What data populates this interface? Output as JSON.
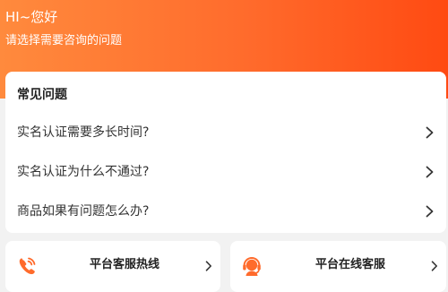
{
  "header": {
    "greeting": "HI~您好",
    "subtitle": "请选择需要咨询的问题",
    "gradient_colors": [
      "#ff8a3d",
      "#ff6b2c",
      "#ff4a12"
    ]
  },
  "faq": {
    "title": "常见问题",
    "items": [
      {
        "label": "实名认证需要多长时间?",
        "icon": "chevron-right-icon"
      },
      {
        "label": "实名认证为什么不通过?",
        "icon": "chevron-right-icon"
      },
      {
        "label": "商品如果有问题怎么办?",
        "icon": "chevron-right-icon"
      }
    ]
  },
  "services": [
    {
      "label": "平台客服热线",
      "icon": "phone-icon"
    },
    {
      "label": "平台在线客服",
      "icon": "headset-agent-icon"
    }
  ],
  "colors": {
    "accent": "#ff6b2c",
    "background": "#f2f2f2",
    "card": "#ffffff",
    "text_primary": "#222222",
    "text_secondary": "#333333"
  }
}
